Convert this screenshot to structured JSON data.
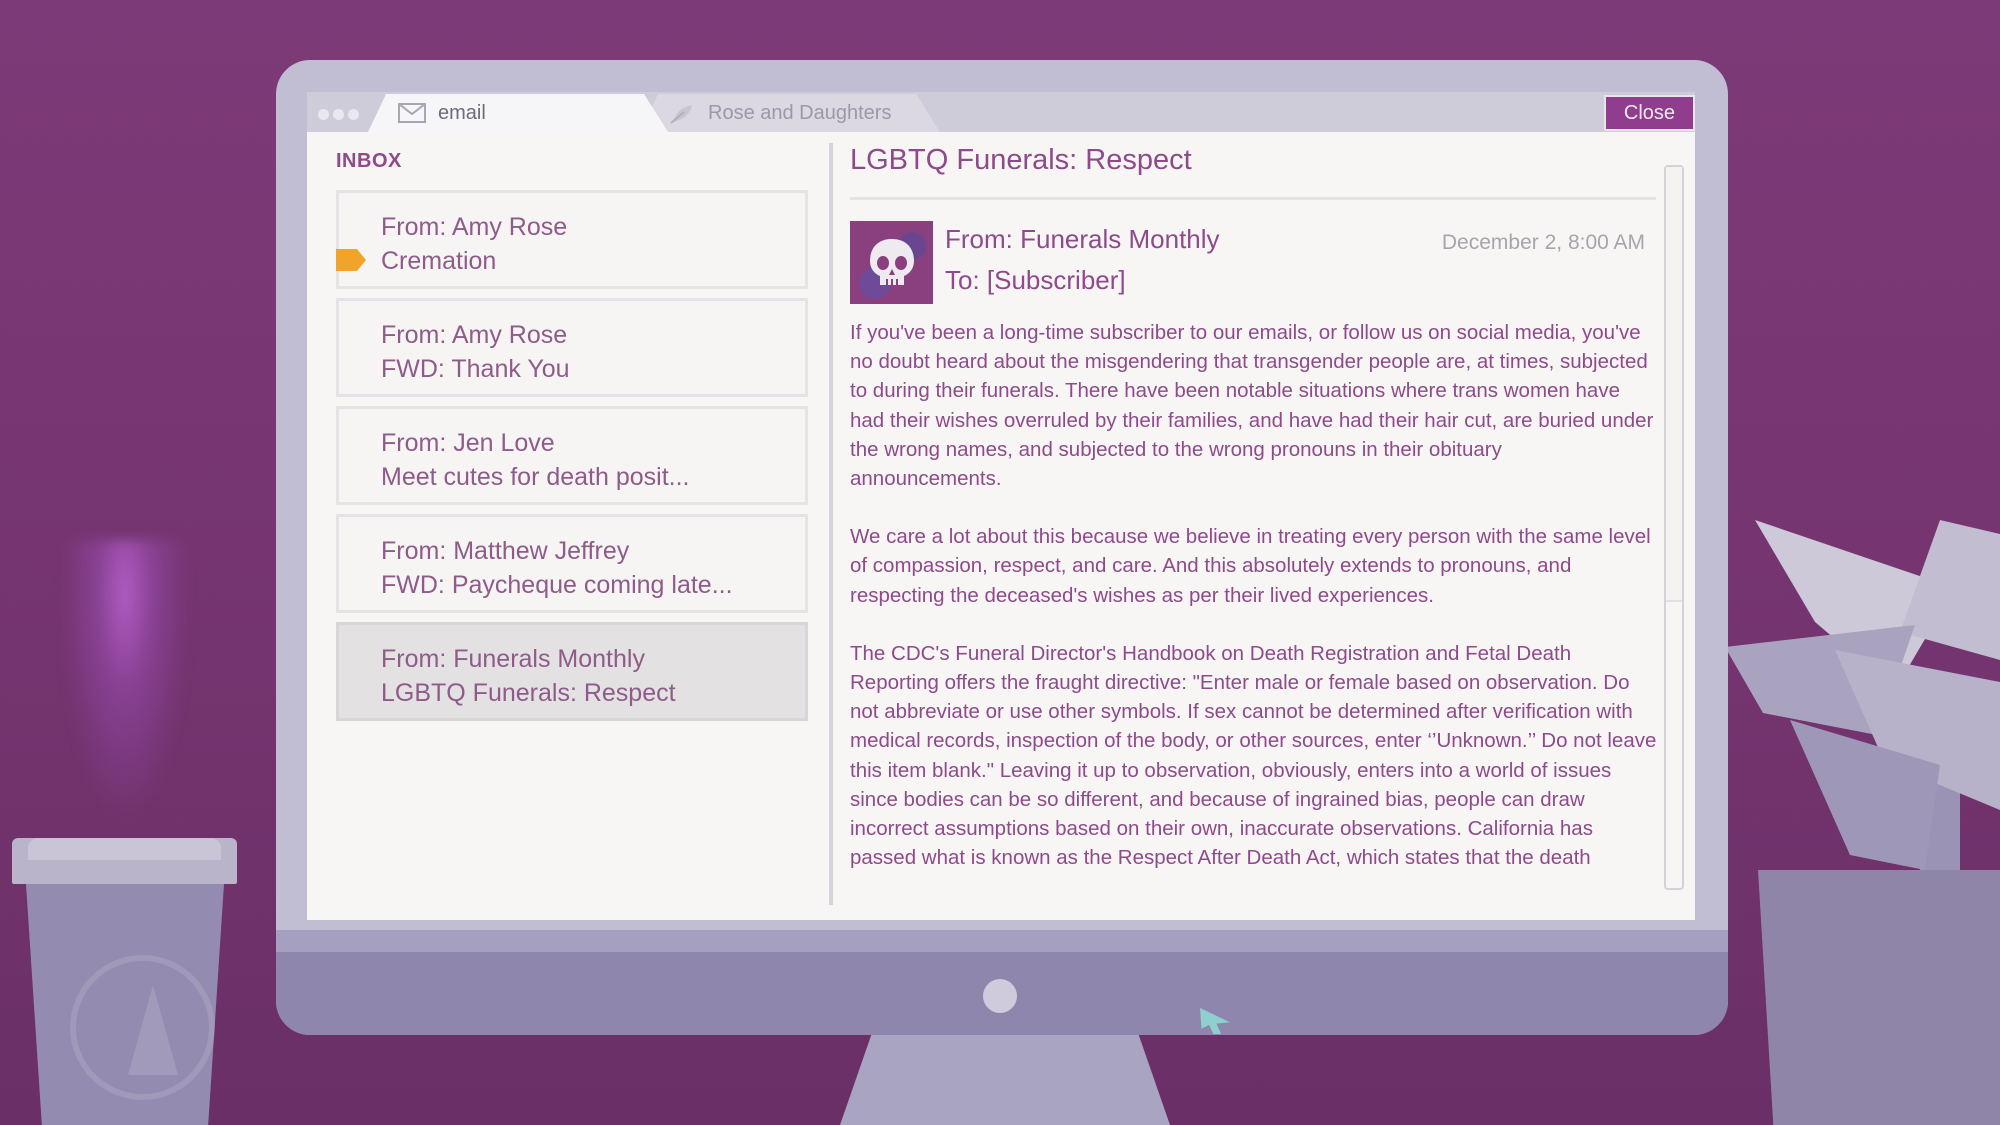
{
  "tabs": [
    {
      "label": "email",
      "icon": "envelope-icon"
    },
    {
      "label": "Rose and Daughters",
      "icon": "leaf-icon"
    }
  ],
  "close_label": "Close",
  "inbox": {
    "title": "INBOX",
    "items": [
      {
        "from": "From: Amy Rose",
        "subject": "Cremation",
        "tagged": true
      },
      {
        "from": "From: Amy Rose",
        "subject": "FWD: Thank You",
        "tagged": false
      },
      {
        "from": "From: Jen Love",
        "subject": "Meet cutes for death posit...",
        "tagged": false
      },
      {
        "from": "From: Matthew Jeffrey",
        "subject": "FWD: Paycheque coming late...",
        "tagged": false
      },
      {
        "from": "From: Funerals Monthly",
        "subject": "LGBTQ Funerals: Respect",
        "tagged": false,
        "selected": true
      }
    ]
  },
  "message": {
    "subject": "LGBTQ Funerals: Respect",
    "from": "From: Funerals Monthly",
    "to": "To: [Subscriber]",
    "date": "December 2, 8:00 AM",
    "avatar_icon": "skull-icon",
    "paragraphs": [
      "If you've been a long-time subscriber to our emails, or follow us on social media, you've no doubt heard about the misgendering that transgender people are, at times, subjected to during their funerals. There have been notable situations where trans women have had their wishes overruled by their families, and have had their hair cut, are buried under the wrong names, and subjected to the wrong pronouns in their obituary announcements.",
      "We care a lot about this because we believe in treating every person with the same level of compassion, respect, and care. And this absolutely extends to pronouns, and respecting the deceased's wishes as per their lived experiences.",
      "The CDC's Funeral Director's Handbook on Death Registration and Fetal Death Reporting offers the fraught directive: \"Enter male or female based on observation. Do not abbreviate or use other symbols. If sex cannot be determined after verification with medical records, inspection of the body, or other sources, enter ‘’Unknown.’’ Do not leave this item blank.\" Leaving it up to observation, obviously, enters into a world of issues since bodies can be so different, and because of ingrained bias, people can draw incorrect assumptions based on their own, inaccurate observations. California has passed what is known as the Respect After Death Act, which states that the death"
    ]
  },
  "colors": {
    "background": "#7d3a78",
    "accent": "#8e4a8b",
    "close_button": "#8f3d8c",
    "tag": "#f0a52a"
  }
}
